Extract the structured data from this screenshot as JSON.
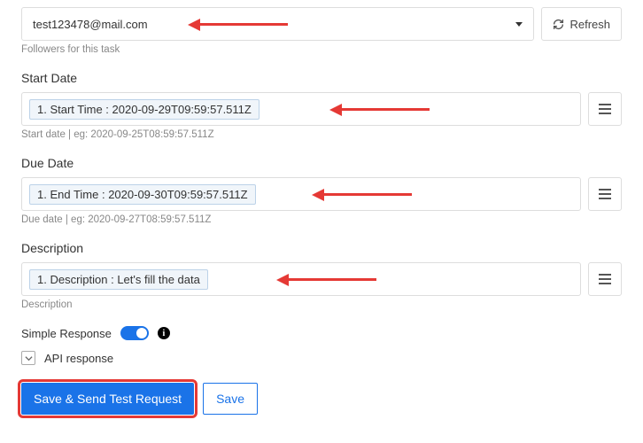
{
  "followers": {
    "value": "test123478@mail.com",
    "helper": "Followers for this task"
  },
  "refresh_label": "Refresh",
  "start_date": {
    "label": "Start Date",
    "chip": "1. Start Time : 2020-09-29T09:59:57.511Z",
    "helper": "Start date | eg: 2020-09-25T08:59:57.511Z"
  },
  "due_date": {
    "label": "Due Date",
    "chip": "1. End Time : 2020-09-30T09:59:57.511Z",
    "helper": "Due date | eg: 2020-09-27T08:59:57.511Z"
  },
  "description": {
    "label": "Description",
    "chip": "1. Description : Let's fill the data",
    "helper": "Description"
  },
  "simple_response_label": "Simple Response",
  "api_response_label": "API response",
  "save_send_label": "Save & Send Test Request",
  "save_label": "Save"
}
